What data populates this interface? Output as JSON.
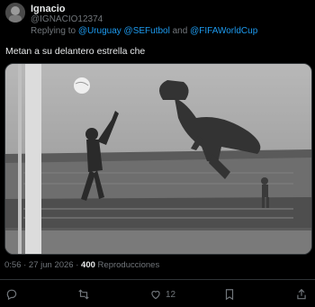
{
  "tweet": {
    "display_name": "Ignacio",
    "handle": "@IGNACIO12374",
    "reply_prefix": "Replying to",
    "mentions": [
      "@Uruguay",
      "@SEFutbol",
      "@FIFAWorldCup"
    ],
    "mention_joiner": "and",
    "text": "Metan a su delantero estrella che",
    "timestamp": "0:56 · 27 jun 2026 ·",
    "views_count": "400",
    "views_label": "Reproducciones",
    "likes_count": "12"
  },
  "icons": {
    "reply": "reply-icon",
    "retweet": "retweet-icon",
    "like": "like-icon",
    "bookmark": "bookmark-icon",
    "share": "share-icon"
  },
  "colors": {
    "background": "#000000",
    "text": "#e7e9ea",
    "muted": "#71767b",
    "link": "#1d9bf0",
    "border": "#2f3336"
  }
}
